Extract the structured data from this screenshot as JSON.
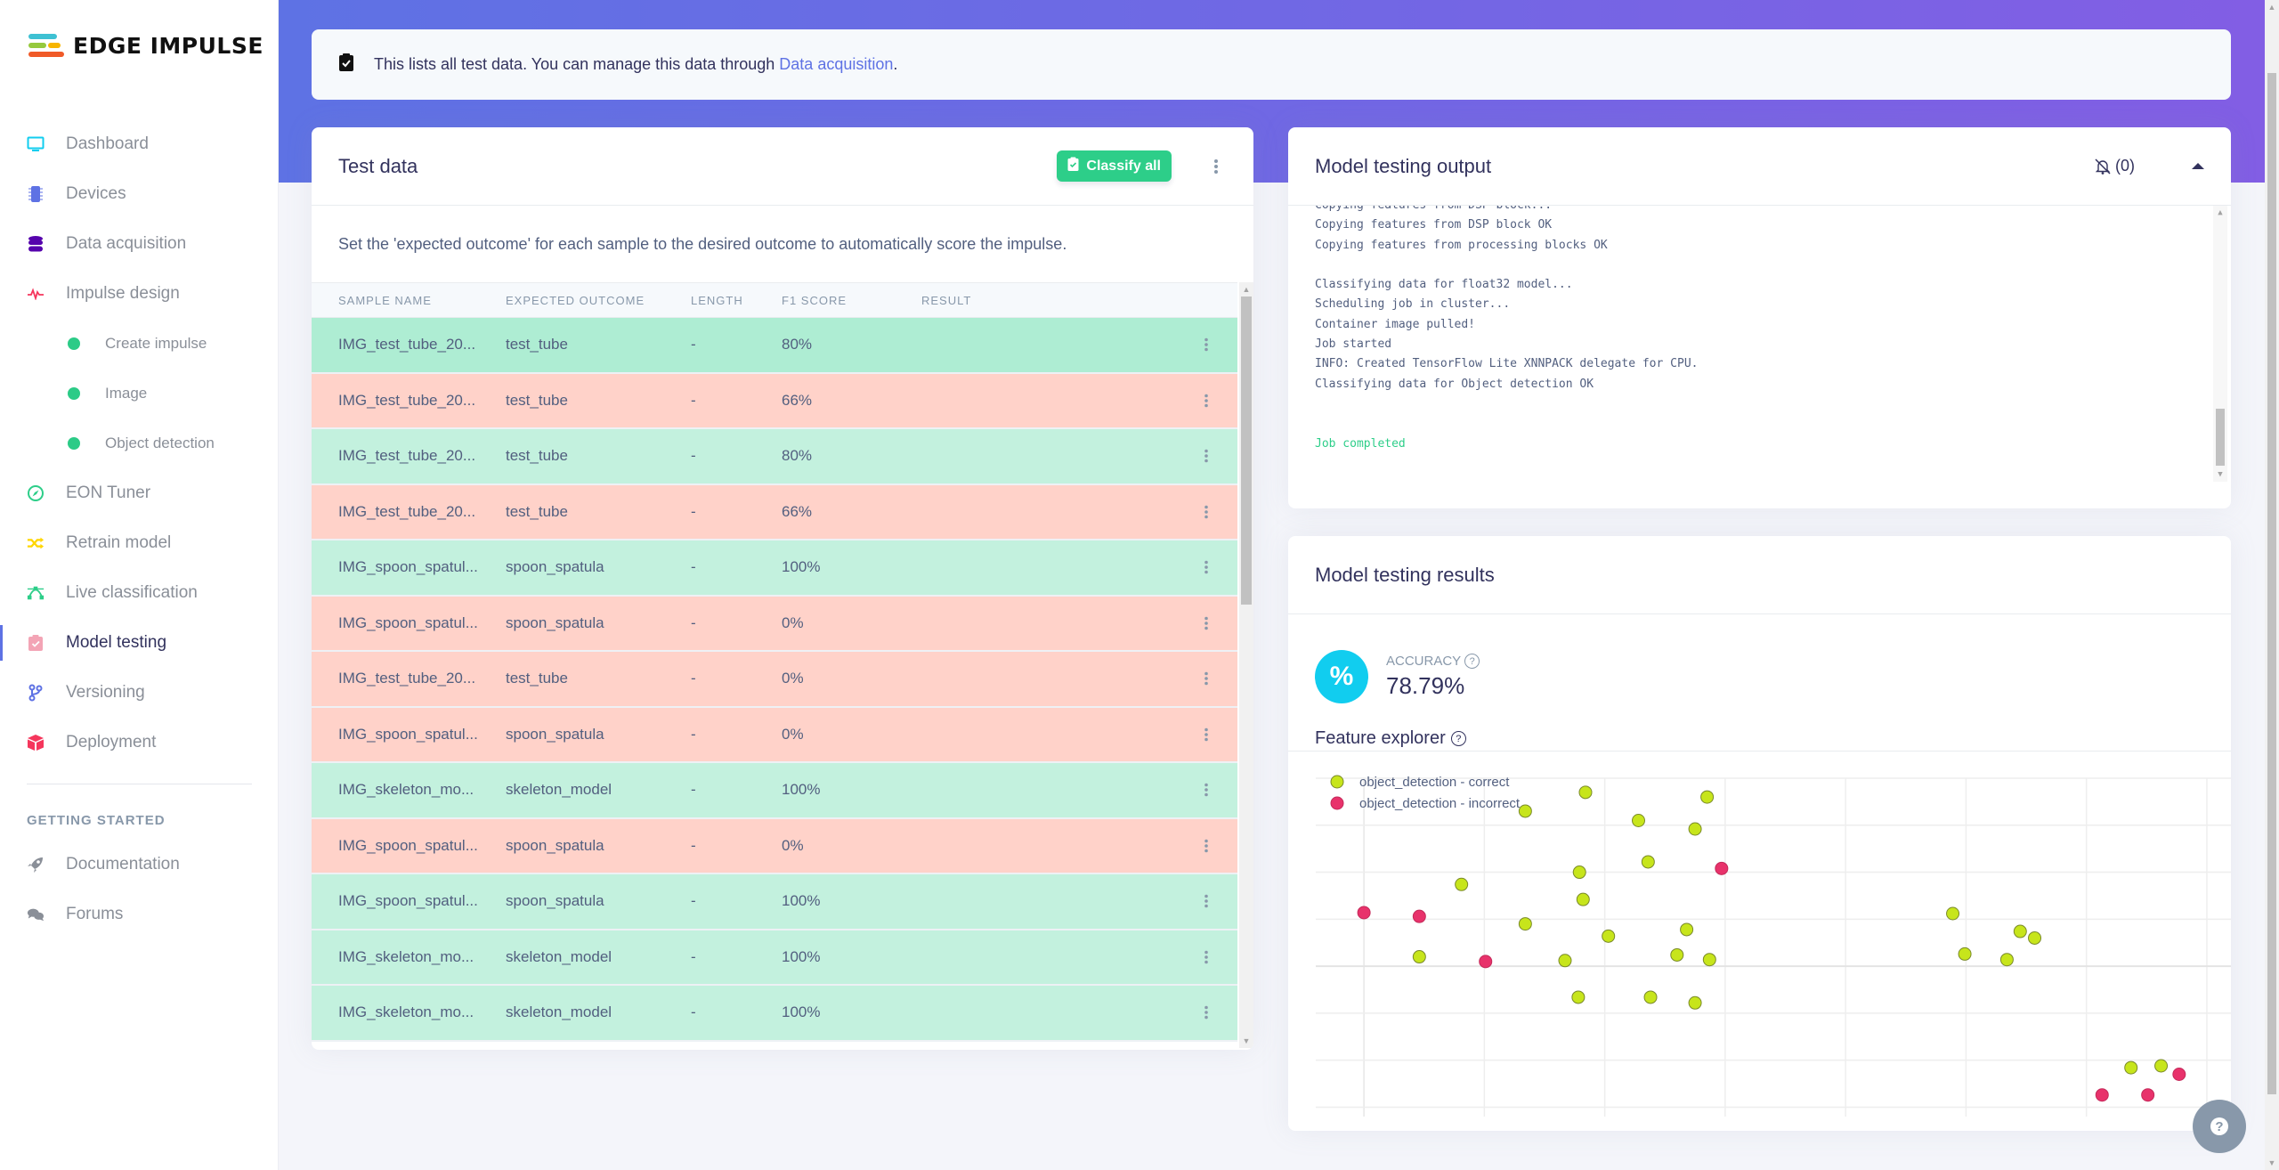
{
  "app": {
    "brand": "EDGE IMPULSE",
    "colors": {
      "brand_primary": "#5e72e4",
      "brand_secondary": "#825ee4",
      "success": "#2dce89",
      "row_correct": "#c3f1de",
      "row_incorrect": "#ffd2c9",
      "accent_cyan": "#11cdef",
      "point_correct": "#c7e51b",
      "point_incorrect": "#e8326b"
    }
  },
  "sidebar": {
    "items": [
      {
        "label": "Dashboard",
        "icon": "monitor-icon"
      },
      {
        "label": "Devices",
        "icon": "chip-icon"
      },
      {
        "label": "Data acquisition",
        "icon": "database-icon"
      },
      {
        "label": "Impulse design",
        "icon": "pulse-icon"
      },
      {
        "label": "Create impulse",
        "icon": "dot-icon",
        "sub": true
      },
      {
        "label": "Image",
        "icon": "dot-icon",
        "sub": true
      },
      {
        "label": "Object detection",
        "icon": "dot-icon",
        "sub": true
      },
      {
        "label": "EON Tuner",
        "icon": "compass-icon"
      },
      {
        "label": "Retrain model",
        "icon": "shuffle-icon"
      },
      {
        "label": "Live classification",
        "icon": "bezier-icon"
      },
      {
        "label": "Model testing",
        "icon": "clipboard-check-icon",
        "active": true
      },
      {
        "label": "Versioning",
        "icon": "branch-icon"
      },
      {
        "label": "Deployment",
        "icon": "cube-icon"
      }
    ],
    "section_heading": "GETTING STARTED",
    "section_items": [
      {
        "label": "Documentation",
        "icon": "rocket-icon"
      },
      {
        "label": "Forums",
        "icon": "comments-icon"
      }
    ]
  },
  "info_bar": {
    "text": "This lists all test data. You can manage this data through ",
    "link": "Data acquisition",
    "suffix": "."
  },
  "test_data": {
    "title": "Test data",
    "classify_all_label": "Classify all",
    "description": "Set the 'expected outcome' for each sample to the desired outcome to automatically score the impulse.",
    "columns": [
      "SAMPLE NAME",
      "EXPECTED OUTCOME",
      "LENGTH",
      "F1 SCORE",
      "RESULT"
    ],
    "rows": [
      {
        "name": "IMG_test_tube_20...",
        "expected": "test_tube",
        "length": "-",
        "f1": "80%",
        "result": "",
        "status": "correct",
        "hover": true
      },
      {
        "name": "IMG_test_tube_20...",
        "expected": "test_tube",
        "length": "-",
        "f1": "66%",
        "result": "",
        "status": "incorrect"
      },
      {
        "name": "IMG_test_tube_20...",
        "expected": "test_tube",
        "length": "-",
        "f1": "80%",
        "result": "",
        "status": "correct"
      },
      {
        "name": "IMG_test_tube_20...",
        "expected": "test_tube",
        "length": "-",
        "f1": "66%",
        "result": "",
        "status": "incorrect"
      },
      {
        "name": "IMG_spoon_spatul...",
        "expected": "spoon_spatula",
        "length": "-",
        "f1": "100%",
        "result": "",
        "status": "correct"
      },
      {
        "name": "IMG_spoon_spatul...",
        "expected": "spoon_spatula",
        "length": "-",
        "f1": "0%",
        "result": "",
        "status": "incorrect"
      },
      {
        "name": "IMG_test_tube_20...",
        "expected": "test_tube",
        "length": "-",
        "f1": "0%",
        "result": "",
        "status": "incorrect"
      },
      {
        "name": "IMG_spoon_spatul...",
        "expected": "spoon_spatula",
        "length": "-",
        "f1": "0%",
        "result": "",
        "status": "incorrect"
      },
      {
        "name": "IMG_skeleton_mo...",
        "expected": "skeleton_model",
        "length": "-",
        "f1": "100%",
        "result": "",
        "status": "correct"
      },
      {
        "name": "IMG_spoon_spatul...",
        "expected": "spoon_spatula",
        "length": "-",
        "f1": "0%",
        "result": "",
        "status": "incorrect"
      },
      {
        "name": "IMG_spoon_spatul...",
        "expected": "spoon_spatula",
        "length": "-",
        "f1": "100%",
        "result": "",
        "status": "correct"
      },
      {
        "name": "IMG_skeleton_mo...",
        "expected": "skeleton_model",
        "length": "-",
        "f1": "100%",
        "result": "",
        "status": "correct"
      },
      {
        "name": "IMG_skeleton_mo...",
        "expected": "skeleton_model",
        "length": "-",
        "f1": "100%",
        "result": "",
        "status": "correct"
      }
    ]
  },
  "output": {
    "title": "Model testing output",
    "notification_count": "(0)",
    "log_lines": [
      {
        "text": "Copying features from DSP block..."
      },
      {
        "text": "Copying features from DSP block OK"
      },
      {
        "text": "Copying features from processing blocks OK"
      },
      {
        "text": ""
      },
      {
        "text": "Classifying data for float32 model..."
      },
      {
        "text": "Scheduling job in cluster..."
      },
      {
        "text": "Container image pulled!"
      },
      {
        "text": "Job started"
      },
      {
        "text": "INFO: Created TensorFlow Lite XNNPACK delegate for CPU."
      },
      {
        "text": "Classifying data for Object detection OK"
      },
      {
        "text": ""
      },
      {
        "text": ""
      },
      {
        "text": "Job completed",
        "success": true
      }
    ]
  },
  "results": {
    "title": "Model testing results",
    "accuracy_label": "ACCURACY",
    "accuracy_value": "78.79%",
    "metric_symbol": "%",
    "feature_explorer_title": "Feature explorer"
  },
  "chart_data": {
    "type": "scatter",
    "title": "Feature explorer",
    "xlabel": "",
    "ylabel": "",
    "xlim": [
      -0.4,
      7.2
    ],
    "ylim": [
      -3.2,
      4.0
    ],
    "grid": true,
    "legend_position": "top-left",
    "series": [
      {
        "name": "object_detection - correct",
        "color": "#c7e51b",
        "points": [
          [
            1.84,
            3.7
          ],
          [
            2.85,
            3.6
          ],
          [
            1.34,
            3.3
          ],
          [
            2.28,
            3.1
          ],
          [
            2.75,
            2.92
          ],
          [
            2.36,
            2.22
          ],
          [
            1.79,
            2.0
          ],
          [
            0.81,
            1.74
          ],
          [
            1.82,
            1.42
          ],
          [
            1.34,
            0.9
          ],
          [
            2.03,
            0.64
          ],
          [
            2.68,
            0.78
          ],
          [
            0.46,
            0.2
          ],
          [
            1.67,
            0.12
          ],
          [
            2.6,
            0.24
          ],
          [
            2.87,
            0.14
          ],
          [
            1.78,
            -0.66
          ],
          [
            2.38,
            -0.66
          ],
          [
            2.75,
            -0.78
          ],
          [
            4.89,
            1.12
          ],
          [
            4.99,
            0.26
          ],
          [
            5.45,
            0.74
          ],
          [
            5.57,
            0.6
          ],
          [
            5.34,
            0.14
          ],
          [
            6.37,
            -2.16
          ],
          [
            6.62,
            -2.12
          ]
        ]
      },
      {
        "name": "object_detection - incorrect",
        "color": "#e8326b",
        "points": [
          [
            0.0,
            1.14
          ],
          [
            0.46,
            1.06
          ],
          [
            1.01,
            0.1
          ],
          [
            2.97,
            2.08
          ],
          [
            6.77,
            -2.3
          ],
          [
            6.13,
            -2.74
          ],
          [
            6.51,
            -2.74
          ]
        ]
      }
    ]
  }
}
